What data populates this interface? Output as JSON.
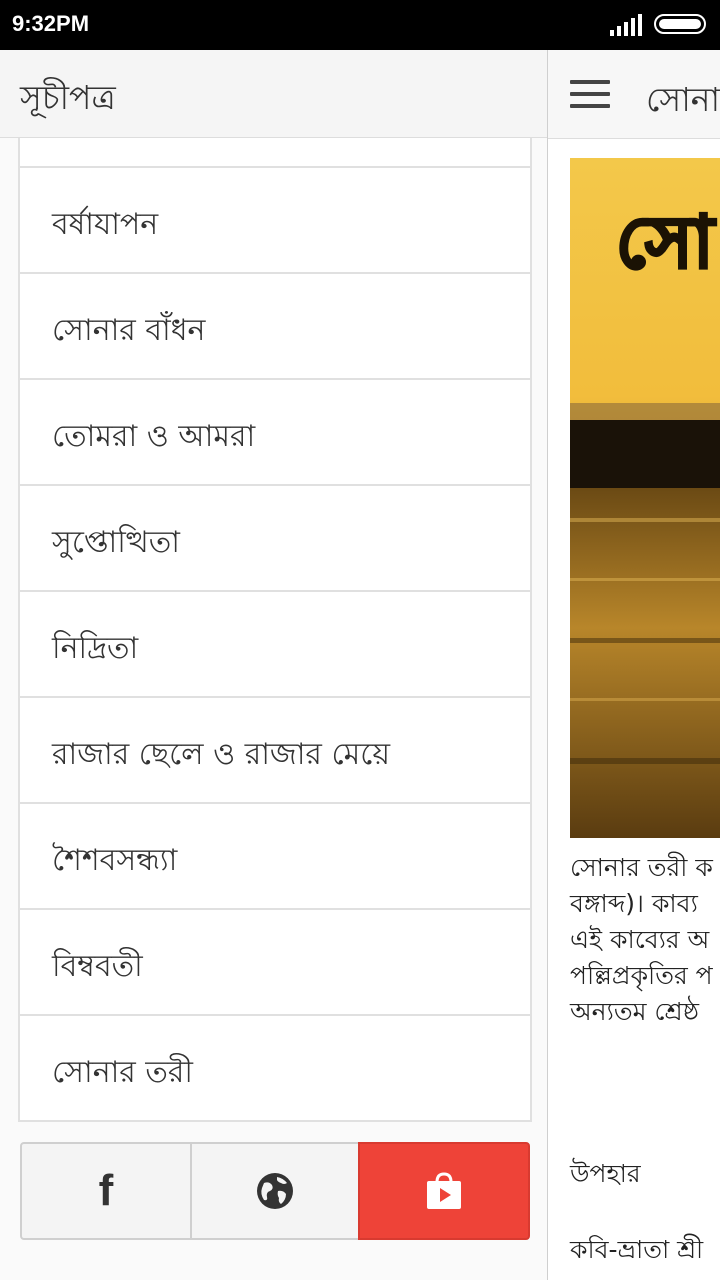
{
  "status_bar": {
    "time": "9:32PM"
  },
  "drawer": {
    "title": "সূচীপত্র",
    "items": [
      {
        "label": "বর্ষাযাপন"
      },
      {
        "label": "সোনার বাঁধন"
      },
      {
        "label": "তোমরা ও আমরা"
      },
      {
        "label": "সুপ্তোত্থিতা"
      },
      {
        "label": "নিদ্রিতা"
      },
      {
        "label": "রাজার ছেলে ও রাজার মেয়ে"
      },
      {
        "label": "শৈশবসন্ধ্যা"
      },
      {
        "label": "বিম্ববতী"
      },
      {
        "label": "সোনার তরী"
      }
    ],
    "social": {
      "facebook_icon": "facebook-icon",
      "web_icon": "globe-icon",
      "store_icon": "play-store-bag-icon"
    }
  },
  "content": {
    "app_title": "সোনা",
    "cover_title": "সো",
    "article_lines": [
      "সোনার তরী ক",
      "বঙ্গাব্দ)। কাব্য",
      "এই কাব্যের অ",
      "পল্লিপ্রকৃতির প",
      "অন্যতম শ্রেষ্ঠ"
    ],
    "section_heading": "উপহার",
    "next_line": "কবি-ভ্রাতা শ্রী"
  },
  "colors": {
    "store_button": "#ee4338",
    "status_bar": "#000000",
    "cover_gold": "#e0a525"
  }
}
